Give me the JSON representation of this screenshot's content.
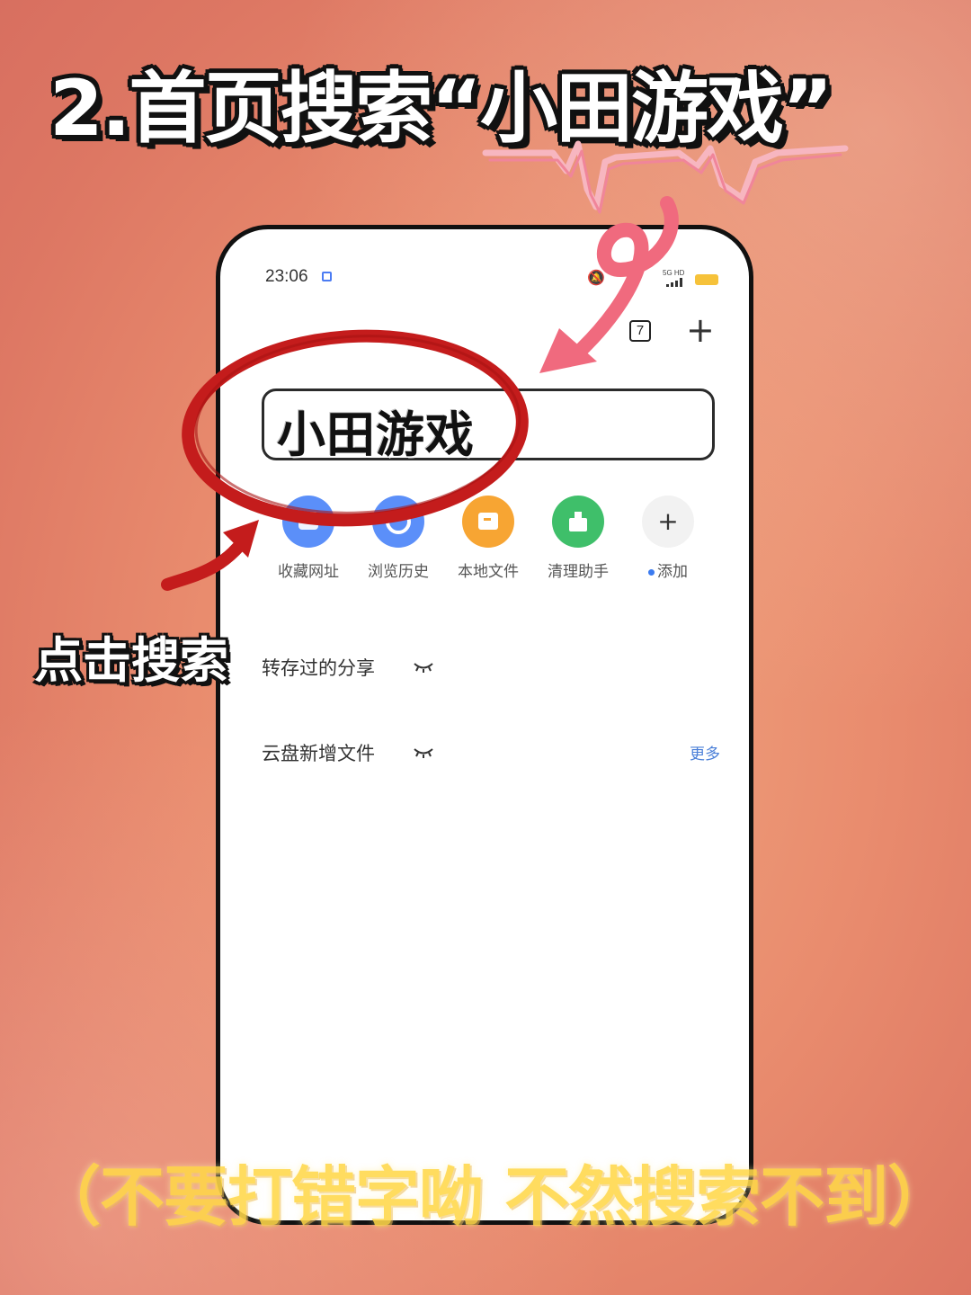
{
  "headline": "2.首页搜索“小田游戏”",
  "status_bar": {
    "time": "23:06",
    "network_label": "5G HD"
  },
  "toolbar": {
    "tab_count": "7",
    "add_tab_symbol": "+"
  },
  "search": {
    "query": "小田游戏"
  },
  "shortcuts": [
    {
      "label": "收藏网址",
      "icon": "bookmark-icon",
      "color": "#5b8ff9"
    },
    {
      "label": "浏览历史",
      "icon": "history-icon",
      "color": "#5b8ff9"
    },
    {
      "label": "本地文件",
      "icon": "folder-icon",
      "color": "#f7a533"
    },
    {
      "label": "清理助手",
      "icon": "cleaner-icon",
      "color": "#3fbf6a"
    },
    {
      "label": "添加",
      "icon": "plus-icon",
      "color": "#f2f2f2"
    }
  ],
  "add_symbol": "+",
  "sections": [
    {
      "title": "转存过的分享",
      "more": ""
    },
    {
      "title": "云盘新增文件",
      "more": "更多"
    }
  ],
  "annotations": {
    "tap_label": "点击搜索",
    "bottom_note": "（不要打错字呦  不然搜索不到）"
  },
  "colors": {
    "annotation_red": "#c41c1c",
    "annotation_pink": "#f06a7e",
    "note_yellow": "#ffd84a"
  }
}
